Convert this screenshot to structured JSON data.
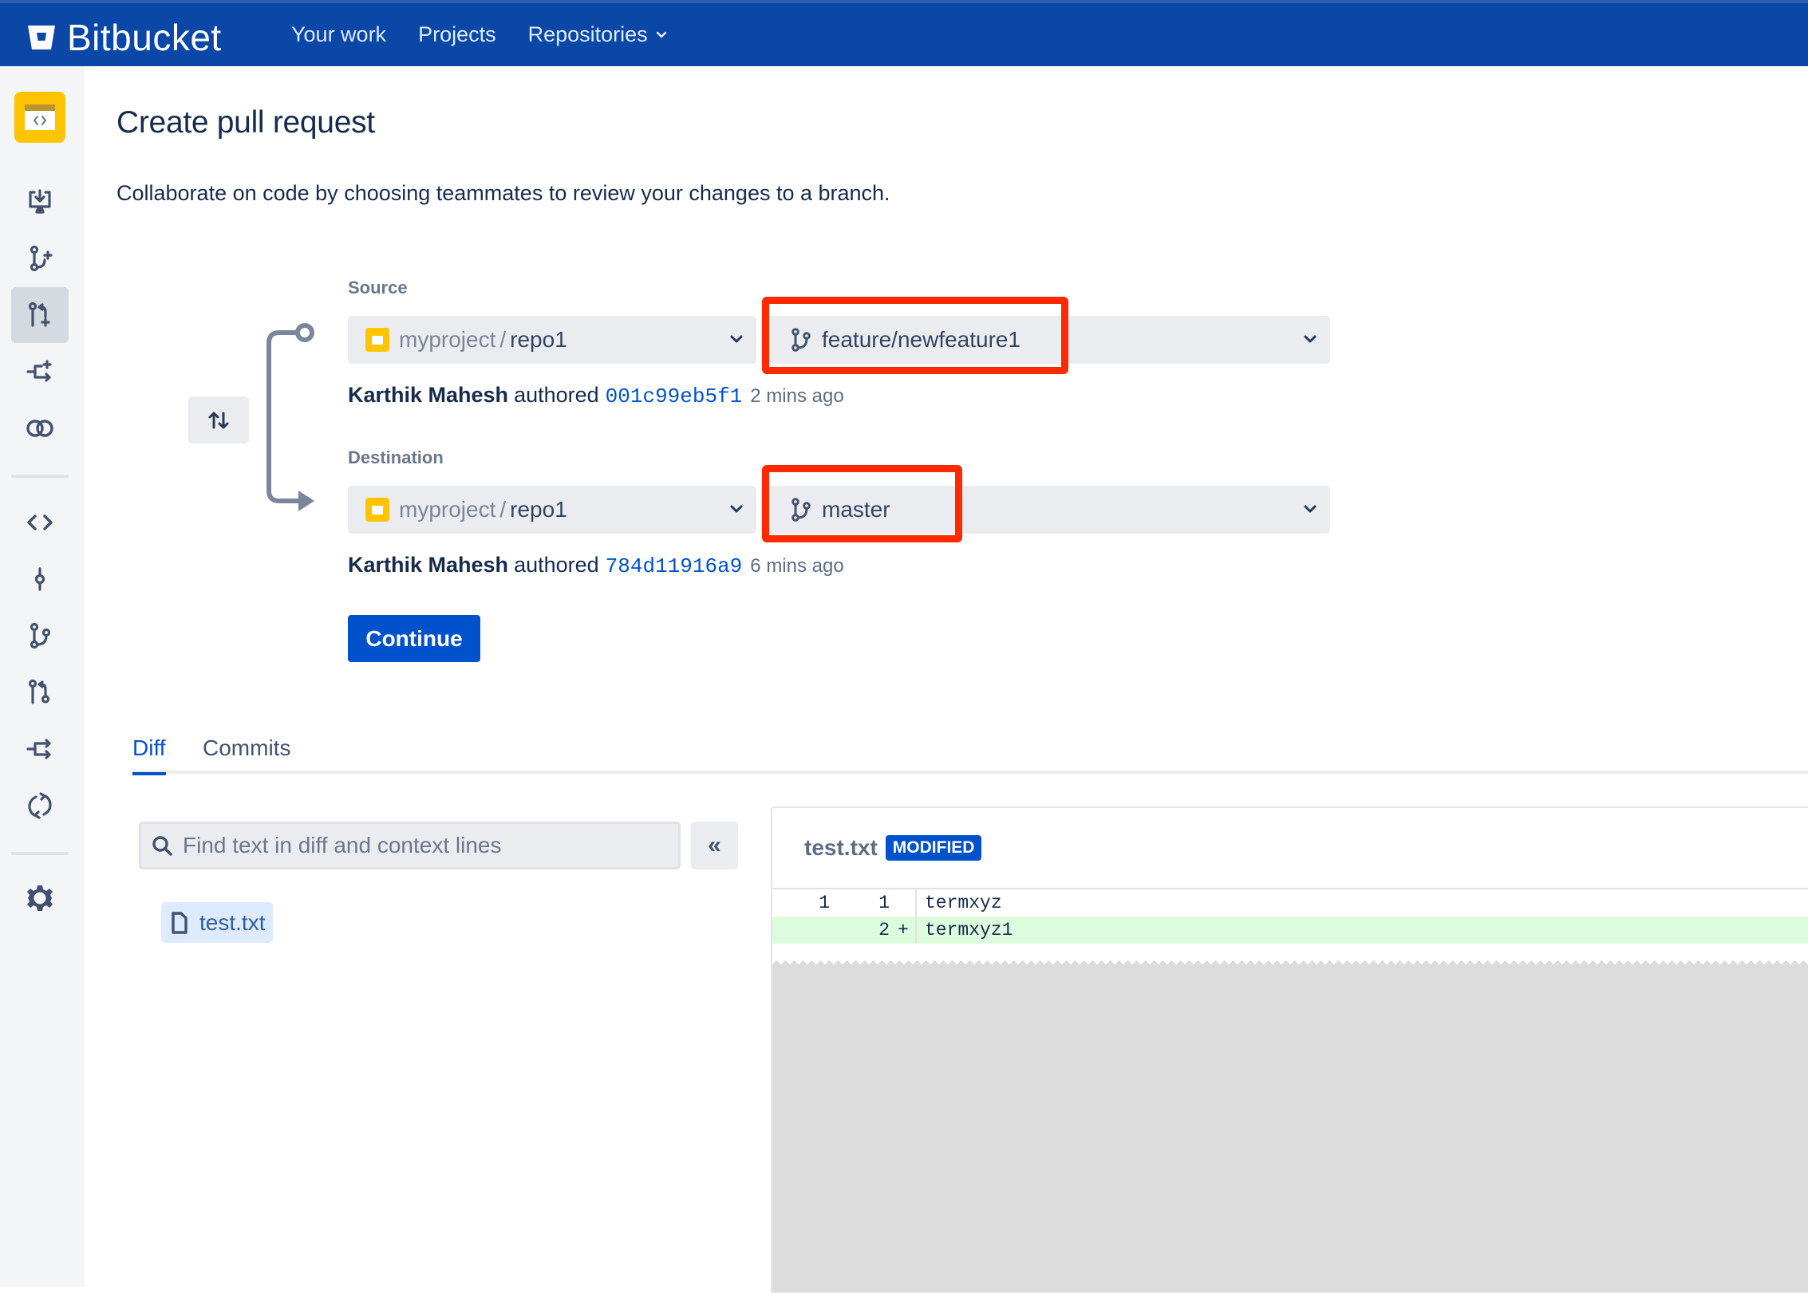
{
  "header": {
    "brand": "Bitbucket",
    "nav": [
      {
        "label": "Your work"
      },
      {
        "label": "Projects"
      },
      {
        "label": "Repositories",
        "has_dropdown": true
      }
    ],
    "color": "#0a47a6"
  },
  "sidebar": {
    "repo_avatar": "repository-icon",
    "items": [
      {
        "icon": "clone-icon",
        "active": false
      },
      {
        "icon": "create-branch-icon",
        "active": false
      },
      {
        "icon": "create-pull-request-icon",
        "active": true
      },
      {
        "icon": "create-fork-icon",
        "active": false
      },
      {
        "icon": "compare-icon",
        "active": false
      },
      {
        "icon": "source-icon",
        "active": false
      },
      {
        "icon": "commits-icon",
        "active": false
      },
      {
        "icon": "branches-icon",
        "active": false
      },
      {
        "icon": "pull-requests-icon",
        "active": false
      },
      {
        "icon": "forks-icon",
        "active": false
      },
      {
        "icon": "builds-icon",
        "active": false
      },
      {
        "icon": "settings-icon",
        "active": false
      }
    ]
  },
  "page": {
    "title": "Create pull request",
    "description": "Collaborate on code by choosing teammates to review your changes to a branch."
  },
  "source": {
    "label": "Source",
    "project": "myproject",
    "separator": "/",
    "repo": "repo1",
    "branch": "feature/newfeature1",
    "author": "Karthik Mahesh",
    "authored_text": "authored",
    "commit": "001c99eb5f1",
    "time": "2 mins ago"
  },
  "destination": {
    "label": "Destination",
    "project": "myproject",
    "separator": "/",
    "repo": "repo1",
    "branch": "master",
    "author": "Karthik Mahesh",
    "authored_text": "authored",
    "commit": "784d11916a9",
    "time": "6 mins ago"
  },
  "actions": {
    "continue_label": "Continue",
    "swap": "swap-branches-icon"
  },
  "tabs": [
    {
      "label": "Diff",
      "active": true
    },
    {
      "label": "Commits",
      "active": false
    }
  ],
  "diff_search": {
    "placeholder": "Find text in diff and context lines",
    "value": "",
    "collapse_label": "«"
  },
  "files": [
    {
      "name": "test.txt"
    }
  ],
  "diff": {
    "filename": "test.txt",
    "status": "MODIFIED",
    "lines": [
      {
        "old": "1",
        "new": "1",
        "marker": "",
        "text": "termxyz",
        "type": "context"
      },
      {
        "old": "",
        "new": "2",
        "marker": "+",
        "text": "termxyz1",
        "type": "added"
      }
    ]
  },
  "annotations": {
    "highlight_color": "#ff2a00",
    "highlighted": [
      "source-branch",
      "destination-branch"
    ]
  }
}
